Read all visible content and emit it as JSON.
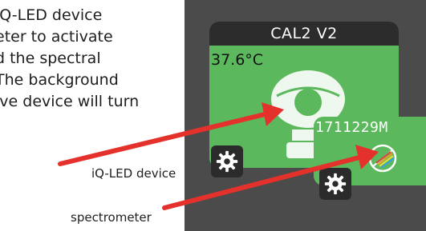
{
  "doc": {
    "lines": [
      "iQ-LED device",
      "eter to activate",
      "d the spectral",
      "The background",
      "ive device will turn"
    ],
    "callout_led": "iQ-LED device",
    "callout_spectrometer": "spectrometer"
  },
  "device": {
    "name": "CAL2 V2",
    "temperature": "37.6°C"
  },
  "spectrometer": {
    "serial": "1711229M"
  },
  "colors": {
    "panel_bg": "#4b4b4b",
    "device_active": "#5cb85c",
    "header_bg": "#2c2c2c",
    "arrow": "#e5312b"
  },
  "icons": [
    "led-lamp-icon",
    "spectrometer-icon",
    "gear-icon"
  ]
}
